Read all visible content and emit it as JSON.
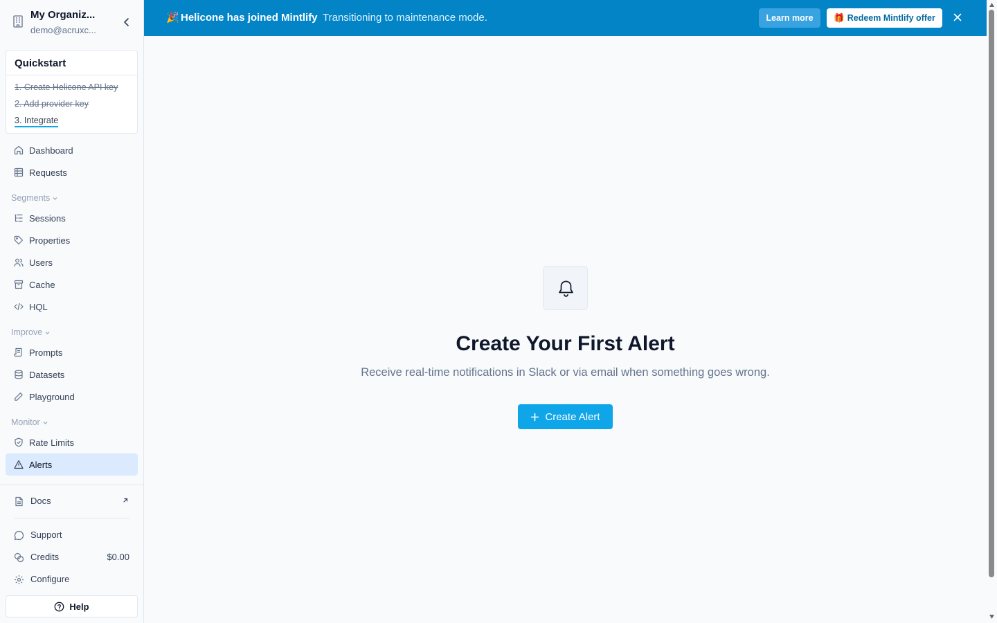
{
  "org": {
    "name": "My Organiz...",
    "email": "demo@acruxc..."
  },
  "quickstart": {
    "title": "Quickstart",
    "steps": [
      {
        "label": "1. Create Helicone API key",
        "status": "done"
      },
      {
        "label": "2. Add provider key",
        "status": "done"
      },
      {
        "label": "3. Integrate",
        "status": "active"
      }
    ]
  },
  "nav": {
    "dashboard": "Dashboard",
    "requests": "Requests",
    "segments_label": "Segments",
    "sessions": "Sessions",
    "properties": "Properties",
    "users": "Users",
    "cache": "Cache",
    "hql": "HQL",
    "improve_label": "Improve",
    "prompts": "Prompts",
    "datasets": "Datasets",
    "playground": "Playground",
    "monitor_label": "Monitor",
    "rate_limits": "Rate Limits",
    "alerts": "Alerts"
  },
  "bottom": {
    "docs": "Docs",
    "support": "Support",
    "credits": "Credits",
    "credits_value": "$0.00",
    "configure": "Configure",
    "help": "Help"
  },
  "banner": {
    "emoji": "🎉",
    "title": "Helicone has joined Mintlify",
    "text": "Transitioning to maintenance mode.",
    "learn_more": "Learn more",
    "redeem_emoji": "🎁",
    "redeem": "Redeem Mintlify offer"
  },
  "main": {
    "title": "Create Your First Alert",
    "subtitle": "Receive real-time notifications in Slack or via email when something goes wrong.",
    "create_button": "Create Alert"
  },
  "colors": {
    "banner": "#0284c7",
    "accent": "#0ea5e9",
    "active_nav": "#dbeafe"
  }
}
